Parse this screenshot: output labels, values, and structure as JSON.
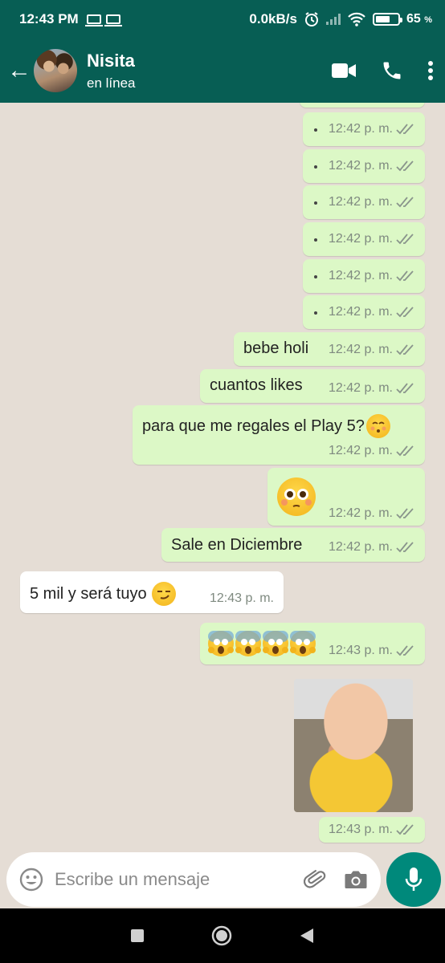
{
  "status_bar": {
    "time": "12:43 PM",
    "speed": "0.0kB/s",
    "battery_pct": "65",
    "battery_unit": "%",
    "battery_level": 0.65
  },
  "header": {
    "contact_name": "Nisita",
    "contact_status": "en línea"
  },
  "icons": {
    "back": "arrow-left-icon",
    "video": "video-call-icon",
    "phone": "phone-icon",
    "menu": "more-vert-icon",
    "emoji": "emoji-icon",
    "attach": "paperclip-icon",
    "camera": "camera-icon",
    "mic": "microphone-icon",
    "ticks": "double-check-icon"
  },
  "colors": {
    "header": "#075e54",
    "outgoing_bubble": "#dcf8c6",
    "incoming_bubble": "#ffffff",
    "chat_bg": "#e5ddd5",
    "accent": "#00897b"
  },
  "messages": [
    {
      "text": ".",
      "time": "12:42 p. m."
    },
    {
      "text": ".",
      "time": "12:42 p. m."
    },
    {
      "text": ".",
      "time": "12:42 p. m."
    },
    {
      "text": ".",
      "time": "12:42 p. m."
    },
    {
      "text": ".",
      "time": "12:42 p. m."
    },
    {
      "text": ".",
      "time": "12:42 p. m."
    },
    {
      "text": "bebe holi",
      "time": "12:42 p. m."
    },
    {
      "text": "cuantos likes",
      "time": "12:42 p. m."
    },
    {
      "text": "para que me regales el Play 5?",
      "emoji": "kissing-face-closed-eyes",
      "time": "12:42 p. m."
    },
    {
      "emoji": "flushed-face",
      "time": "12:42 p. m."
    },
    {
      "text": "Sale en Diciembre",
      "time": "12:42 p. m."
    },
    {
      "text": "5 mil y será tuyo",
      "emoji": "smirking-face",
      "time": "12:43 p. m."
    },
    {
      "emoji": "face-screaming-in-fear x4",
      "time": "12:43 p. m."
    },
    {
      "sticker": "crying-baby-sticker",
      "time": "12:43 p. m."
    }
  ],
  "input": {
    "placeholder": "Escribe un mensaje"
  }
}
